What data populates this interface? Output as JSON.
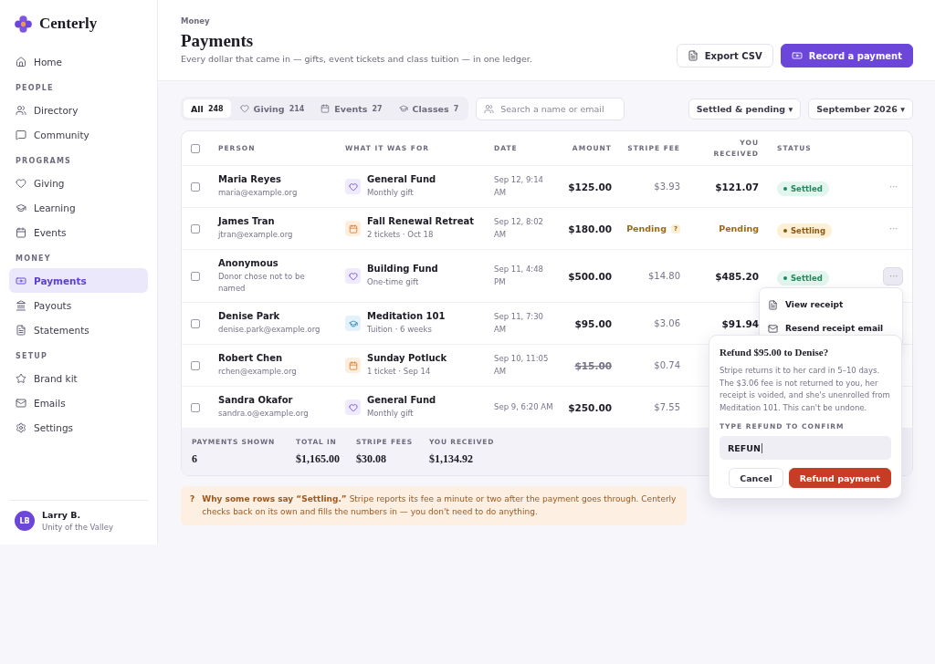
{
  "brand": {
    "name": "Centerly"
  },
  "sidebar": {
    "sections": [
      {
        "items": [
          {
            "label": "Home",
            "selected": false
          }
        ]
      },
      {
        "heading": "PEOPLE",
        "items": [
          {
            "label": "Directory",
            "selected": false
          },
          {
            "label": "Community",
            "selected": false
          }
        ]
      },
      {
        "heading": "PROGRAMS",
        "items": [
          {
            "label": "Giving",
            "selected": false
          },
          {
            "label": "Learning",
            "selected": false
          },
          {
            "label": "Events",
            "selected": false
          }
        ]
      },
      {
        "heading": "MONEY",
        "items": [
          {
            "label": "Payments",
            "selected": true
          },
          {
            "label": "Payouts",
            "selected": false
          },
          {
            "label": "Statements",
            "selected": false
          }
        ]
      },
      {
        "heading": "SETUP",
        "items": [
          {
            "label": "Brand kit",
            "selected": false
          },
          {
            "label": "Emails",
            "selected": false
          },
          {
            "label": "Settings",
            "selected": false
          }
        ]
      }
    ],
    "user": {
      "initials": "LB",
      "name": "Larry B.",
      "org": "Unity of the Valley"
    }
  },
  "header": {
    "eyebrow": "Money",
    "title": "Payments",
    "subtitle": "Every dollar that came in — gifts, event tickets and class tuition — in one ledger.",
    "buttons": [
      {
        "label": "Export CSV",
        "kind": "secondary"
      },
      {
        "label": "Record a payment",
        "kind": "primary"
      }
    ]
  },
  "filters": {
    "tabs": [
      {
        "label": "All",
        "count": "248",
        "selected": true
      },
      {
        "label": "Giving",
        "count": "214",
        "selected": false
      },
      {
        "label": "Events",
        "count": "27",
        "selected": false
      },
      {
        "label": "Classes",
        "count": "7",
        "selected": false
      }
    ],
    "search": {
      "placeholder": "Search a name or email"
    },
    "dropdowns": [
      {
        "label": "Settled & pending ▾"
      },
      {
        "label": "September 2026 ▾"
      }
    ]
  },
  "table": {
    "columns": [
      "PERSON",
      "WHAT IT WAS FOR",
      "DATE",
      "AMOUNT",
      "STRIPE FEE",
      "YOU RECEIVED",
      "STATUS"
    ],
    "header_checkbox": {
      "checked": false
    },
    "rows": [
      {
        "checked": false,
        "name": "Maria Reyes",
        "sub": "maria@example.org",
        "kind": "giving",
        "item": "General Fund",
        "detail": "Monthly gift",
        "date": "Sep 12, 9:14 AM",
        "amount": "$125.00",
        "amount_struck": false,
        "fee": {
          "kind": "amount",
          "text": "$3.93"
        },
        "received": {
          "kind": "amount",
          "text": "$121.07"
        },
        "status": {
          "kind": "settled",
          "label": "Settled"
        },
        "menu": {
          "label": "···",
          "open": false
        }
      },
      {
        "checked": false,
        "name": "James Tran",
        "sub": "jtran@example.org",
        "kind": "event",
        "item": "Fall Renewal Retreat",
        "detail": "2 tickets · Oct 18",
        "date": "Sep 12, 8:02 AM",
        "amount": "$180.00",
        "amount_struck": false,
        "fee": {
          "kind": "pending",
          "text": "Pending",
          "hint": "?"
        },
        "received": {
          "kind": "pending",
          "text": "Pending"
        },
        "status": {
          "kind": "settling",
          "label": "Settling"
        },
        "menu": {
          "label": "···",
          "open": false
        }
      },
      {
        "checked": false,
        "name": "Anonymous",
        "sub": "Donor chose not to be named",
        "kind": "giving",
        "item": "Building Fund",
        "detail": "One-time gift",
        "date": "Sep 11, 4:48 PM",
        "amount": "$500.00",
        "amount_struck": false,
        "fee": {
          "kind": "amount",
          "text": "$14.80"
        },
        "received": {
          "kind": "amount",
          "text": "$485.20"
        },
        "status": {
          "kind": "settled",
          "label": "Settled"
        },
        "menu": {
          "label": "···",
          "open": true
        }
      },
      {
        "checked": false,
        "name": "Denise Park",
        "sub": "denise.park@example.org",
        "kind": "class",
        "item": "Meditation 101",
        "detail": "Tuition · 6 weeks",
        "date": "Sep 11, 7:30 AM",
        "amount": "$95.00",
        "amount_struck": false,
        "fee": {
          "kind": "amount",
          "text": "$3.06"
        },
        "received": {
          "kind": "amount",
          "text": "$91.94"
        }
      },
      {
        "checked": false,
        "name": "Robert Chen",
        "sub": "rchen@example.org",
        "kind": "event",
        "item": "Sunday Potluck",
        "detail": "1 ticket · Sep 14",
        "date": "Sep 10, 11:05 AM",
        "amount": "$15.00",
        "amount_struck": true,
        "fee": {
          "kind": "amount",
          "text": "$0.74"
        }
      },
      {
        "checked": false,
        "name": "Sandra Okafor",
        "sub": "sandra.o@example.org",
        "kind": "giving",
        "item": "General Fund",
        "detail": "Monthly gift",
        "date": "Sep 9, 6:20 AM",
        "amount": "$250.00",
        "amount_struck": false,
        "fee": {
          "kind": "amount",
          "text": "$7.55"
        }
      }
    ],
    "totals": [
      {
        "label": "PAYMENTS SHOWN",
        "value": "6"
      },
      {
        "label": "TOTAL IN",
        "value": "$1,165.00"
      },
      {
        "label": "STRIPE FEES",
        "value": "$30.08"
      },
      {
        "label": "YOU RECEIVED",
        "value": "$1,134.92"
      }
    ]
  },
  "row_menu": {
    "items": [
      {
        "label": "View receipt"
      },
      {
        "label": "Resend receipt email"
      }
    ]
  },
  "refund_dialog": {
    "title": "Refund $95.00 to Denise?",
    "body": "Stripe returns it to her card in 5–10 days. The $3.06 fee is not returned to you, her receipt is voided, and she's unenrolled from Meditation 101. This can't be undone.",
    "field_label": "TYPE REFUND TO CONFIRM",
    "value": "REFUN",
    "buttons": [
      {
        "label": "Cancel",
        "kind": "secondary"
      },
      {
        "label": "Refund payment",
        "kind": "danger"
      }
    ]
  },
  "notice": {
    "mark": "?",
    "text": "**Why some rows say “Settling.”** Stripe reports its fee a minute or two after the payment goes through. Centerly checks back on its own and fills the numbers in — you don't need to do anything."
  }
}
